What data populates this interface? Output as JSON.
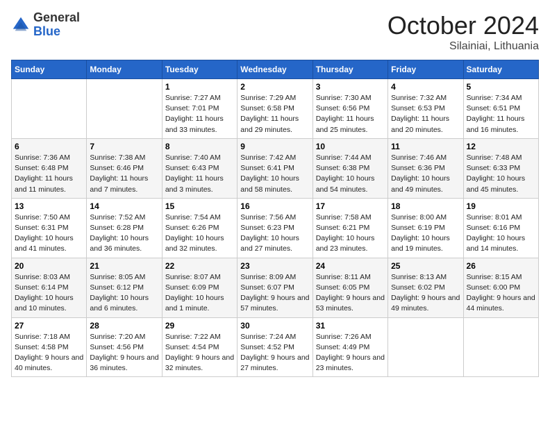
{
  "header": {
    "logo_general": "General",
    "logo_blue": "Blue",
    "month_title": "October 2024",
    "location": "Silainiai, Lithuania"
  },
  "days_of_week": [
    "Sunday",
    "Monday",
    "Tuesday",
    "Wednesday",
    "Thursday",
    "Friday",
    "Saturday"
  ],
  "weeks": [
    [
      {
        "num": "",
        "info": ""
      },
      {
        "num": "",
        "info": ""
      },
      {
        "num": "1",
        "info": "Sunrise: 7:27 AM\nSunset: 7:01 PM\nDaylight: 11 hours and 33 minutes."
      },
      {
        "num": "2",
        "info": "Sunrise: 7:29 AM\nSunset: 6:58 PM\nDaylight: 11 hours and 29 minutes."
      },
      {
        "num": "3",
        "info": "Sunrise: 7:30 AM\nSunset: 6:56 PM\nDaylight: 11 hours and 25 minutes."
      },
      {
        "num": "4",
        "info": "Sunrise: 7:32 AM\nSunset: 6:53 PM\nDaylight: 11 hours and 20 minutes."
      },
      {
        "num": "5",
        "info": "Sunrise: 7:34 AM\nSunset: 6:51 PM\nDaylight: 11 hours and 16 minutes."
      }
    ],
    [
      {
        "num": "6",
        "info": "Sunrise: 7:36 AM\nSunset: 6:48 PM\nDaylight: 11 hours and 11 minutes."
      },
      {
        "num": "7",
        "info": "Sunrise: 7:38 AM\nSunset: 6:46 PM\nDaylight: 11 hours and 7 minutes."
      },
      {
        "num": "8",
        "info": "Sunrise: 7:40 AM\nSunset: 6:43 PM\nDaylight: 11 hours and 3 minutes."
      },
      {
        "num": "9",
        "info": "Sunrise: 7:42 AM\nSunset: 6:41 PM\nDaylight: 10 hours and 58 minutes."
      },
      {
        "num": "10",
        "info": "Sunrise: 7:44 AM\nSunset: 6:38 PM\nDaylight: 10 hours and 54 minutes."
      },
      {
        "num": "11",
        "info": "Sunrise: 7:46 AM\nSunset: 6:36 PM\nDaylight: 10 hours and 49 minutes."
      },
      {
        "num": "12",
        "info": "Sunrise: 7:48 AM\nSunset: 6:33 PM\nDaylight: 10 hours and 45 minutes."
      }
    ],
    [
      {
        "num": "13",
        "info": "Sunrise: 7:50 AM\nSunset: 6:31 PM\nDaylight: 10 hours and 41 minutes."
      },
      {
        "num": "14",
        "info": "Sunrise: 7:52 AM\nSunset: 6:28 PM\nDaylight: 10 hours and 36 minutes."
      },
      {
        "num": "15",
        "info": "Sunrise: 7:54 AM\nSunset: 6:26 PM\nDaylight: 10 hours and 32 minutes."
      },
      {
        "num": "16",
        "info": "Sunrise: 7:56 AM\nSunset: 6:23 PM\nDaylight: 10 hours and 27 minutes."
      },
      {
        "num": "17",
        "info": "Sunrise: 7:58 AM\nSunset: 6:21 PM\nDaylight: 10 hours and 23 minutes."
      },
      {
        "num": "18",
        "info": "Sunrise: 8:00 AM\nSunset: 6:19 PM\nDaylight: 10 hours and 19 minutes."
      },
      {
        "num": "19",
        "info": "Sunrise: 8:01 AM\nSunset: 6:16 PM\nDaylight: 10 hours and 14 minutes."
      }
    ],
    [
      {
        "num": "20",
        "info": "Sunrise: 8:03 AM\nSunset: 6:14 PM\nDaylight: 10 hours and 10 minutes."
      },
      {
        "num": "21",
        "info": "Sunrise: 8:05 AM\nSunset: 6:12 PM\nDaylight: 10 hours and 6 minutes."
      },
      {
        "num": "22",
        "info": "Sunrise: 8:07 AM\nSunset: 6:09 PM\nDaylight: 10 hours and 1 minute."
      },
      {
        "num": "23",
        "info": "Sunrise: 8:09 AM\nSunset: 6:07 PM\nDaylight: 9 hours and 57 minutes."
      },
      {
        "num": "24",
        "info": "Sunrise: 8:11 AM\nSunset: 6:05 PM\nDaylight: 9 hours and 53 minutes."
      },
      {
        "num": "25",
        "info": "Sunrise: 8:13 AM\nSunset: 6:02 PM\nDaylight: 9 hours and 49 minutes."
      },
      {
        "num": "26",
        "info": "Sunrise: 8:15 AM\nSunset: 6:00 PM\nDaylight: 9 hours and 44 minutes."
      }
    ],
    [
      {
        "num": "27",
        "info": "Sunrise: 7:18 AM\nSunset: 4:58 PM\nDaylight: 9 hours and 40 minutes."
      },
      {
        "num": "28",
        "info": "Sunrise: 7:20 AM\nSunset: 4:56 PM\nDaylight: 9 hours and 36 minutes."
      },
      {
        "num": "29",
        "info": "Sunrise: 7:22 AM\nSunset: 4:54 PM\nDaylight: 9 hours and 32 minutes."
      },
      {
        "num": "30",
        "info": "Sunrise: 7:24 AM\nSunset: 4:52 PM\nDaylight: 9 hours and 27 minutes."
      },
      {
        "num": "31",
        "info": "Sunrise: 7:26 AM\nSunset: 4:49 PM\nDaylight: 9 hours and 23 minutes."
      },
      {
        "num": "",
        "info": ""
      },
      {
        "num": "",
        "info": ""
      }
    ]
  ]
}
